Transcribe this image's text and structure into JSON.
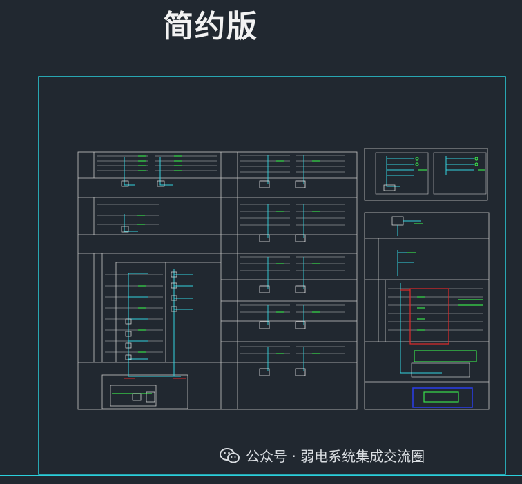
{
  "title": "简约版",
  "watermark": {
    "text": "公众号 · 弱电系统集成交流圈",
    "icon": "wechat-icon"
  },
  "colors": {
    "background": "#212830",
    "frame": "#2bd0dc",
    "line_white": "#c8c8c8",
    "line_cyan": "#33d4e0",
    "line_green": "#39e04a",
    "line_red": "#e02a2a",
    "line_blue": "#2a3de0"
  },
  "panels": [
    {
      "name": "main-system-diagram",
      "caption": ""
    },
    {
      "name": "top-right-diagram",
      "caption": ""
    },
    {
      "name": "bottom-right-diagram",
      "caption": ""
    }
  ]
}
